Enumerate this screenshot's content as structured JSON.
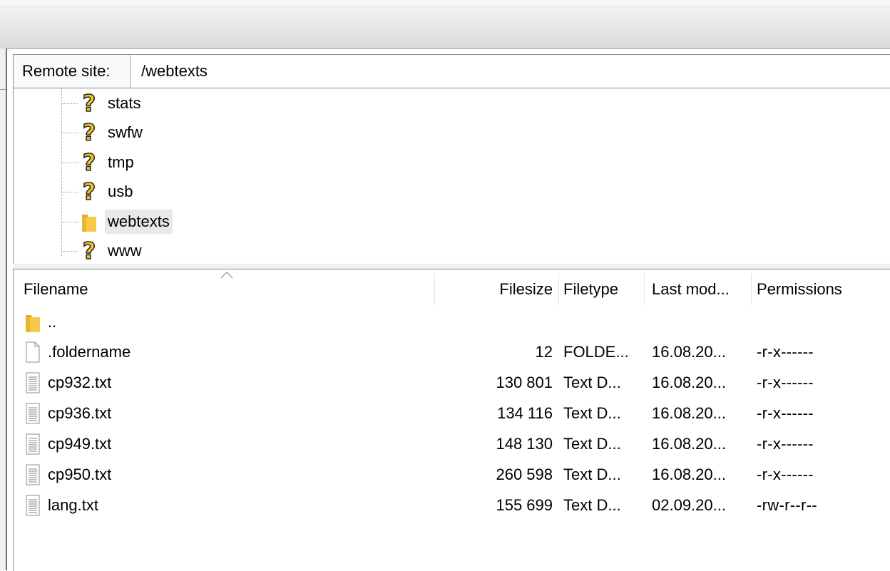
{
  "remote_site": {
    "label": "Remote site:",
    "path": "/webtexts"
  },
  "tree": {
    "items": [
      {
        "name": "stats",
        "icon": "unknown-question-icon",
        "selected": false
      },
      {
        "name": "swfw",
        "icon": "unknown-question-icon",
        "selected": false
      },
      {
        "name": "tmp",
        "icon": "unknown-question-icon",
        "selected": false
      },
      {
        "name": "usb",
        "icon": "unknown-question-icon",
        "selected": false
      },
      {
        "name": "webtexts",
        "icon": "folder-icon",
        "selected": true
      },
      {
        "name": "www",
        "icon": "unknown-question-icon",
        "selected": false
      }
    ]
  },
  "file_list": {
    "columns": {
      "filename": "Filename",
      "filesize": "Filesize",
      "filetype": "Filetype",
      "last_modified": "Last mod...",
      "permissions": "Permissions"
    },
    "sort": {
      "column": "filename",
      "direction": "ascending"
    },
    "rows": [
      {
        "name": "..",
        "size": "",
        "type": "",
        "modified": "",
        "permissions": "",
        "icon": "folder-icon"
      },
      {
        "name": ".foldername",
        "size": "12",
        "type": "FOLDE...",
        "modified": "16.08.20...",
        "permissions": "-r-x------",
        "icon": "blank-file-icon"
      },
      {
        "name": "cp932.txt",
        "size": "130 801",
        "type": "Text D...",
        "modified": "16.08.20...",
        "permissions": "-r-x------",
        "icon": "text-file-icon"
      },
      {
        "name": "cp936.txt",
        "size": "134 116",
        "type": "Text D...",
        "modified": "16.08.20...",
        "permissions": "-r-x------",
        "icon": "text-file-icon"
      },
      {
        "name": "cp949.txt",
        "size": "148 130",
        "type": "Text D...",
        "modified": "16.08.20...",
        "permissions": "-r-x------",
        "icon": "text-file-icon"
      },
      {
        "name": "cp950.txt",
        "size": "260 598",
        "type": "Text D...",
        "modified": "16.08.20...",
        "permissions": "-r-x------",
        "icon": "text-file-icon"
      },
      {
        "name": "lang.txt",
        "size": "155 699",
        "type": "Text D...",
        "modified": "02.09.20...",
        "permissions": "-rw-r--r--",
        "icon": "text-file-icon"
      }
    ]
  },
  "colors": {
    "folder": "#f7c948",
    "question_mark": "#f5c518",
    "selection": "#e8e8e8",
    "border": "#8a8a8a"
  }
}
